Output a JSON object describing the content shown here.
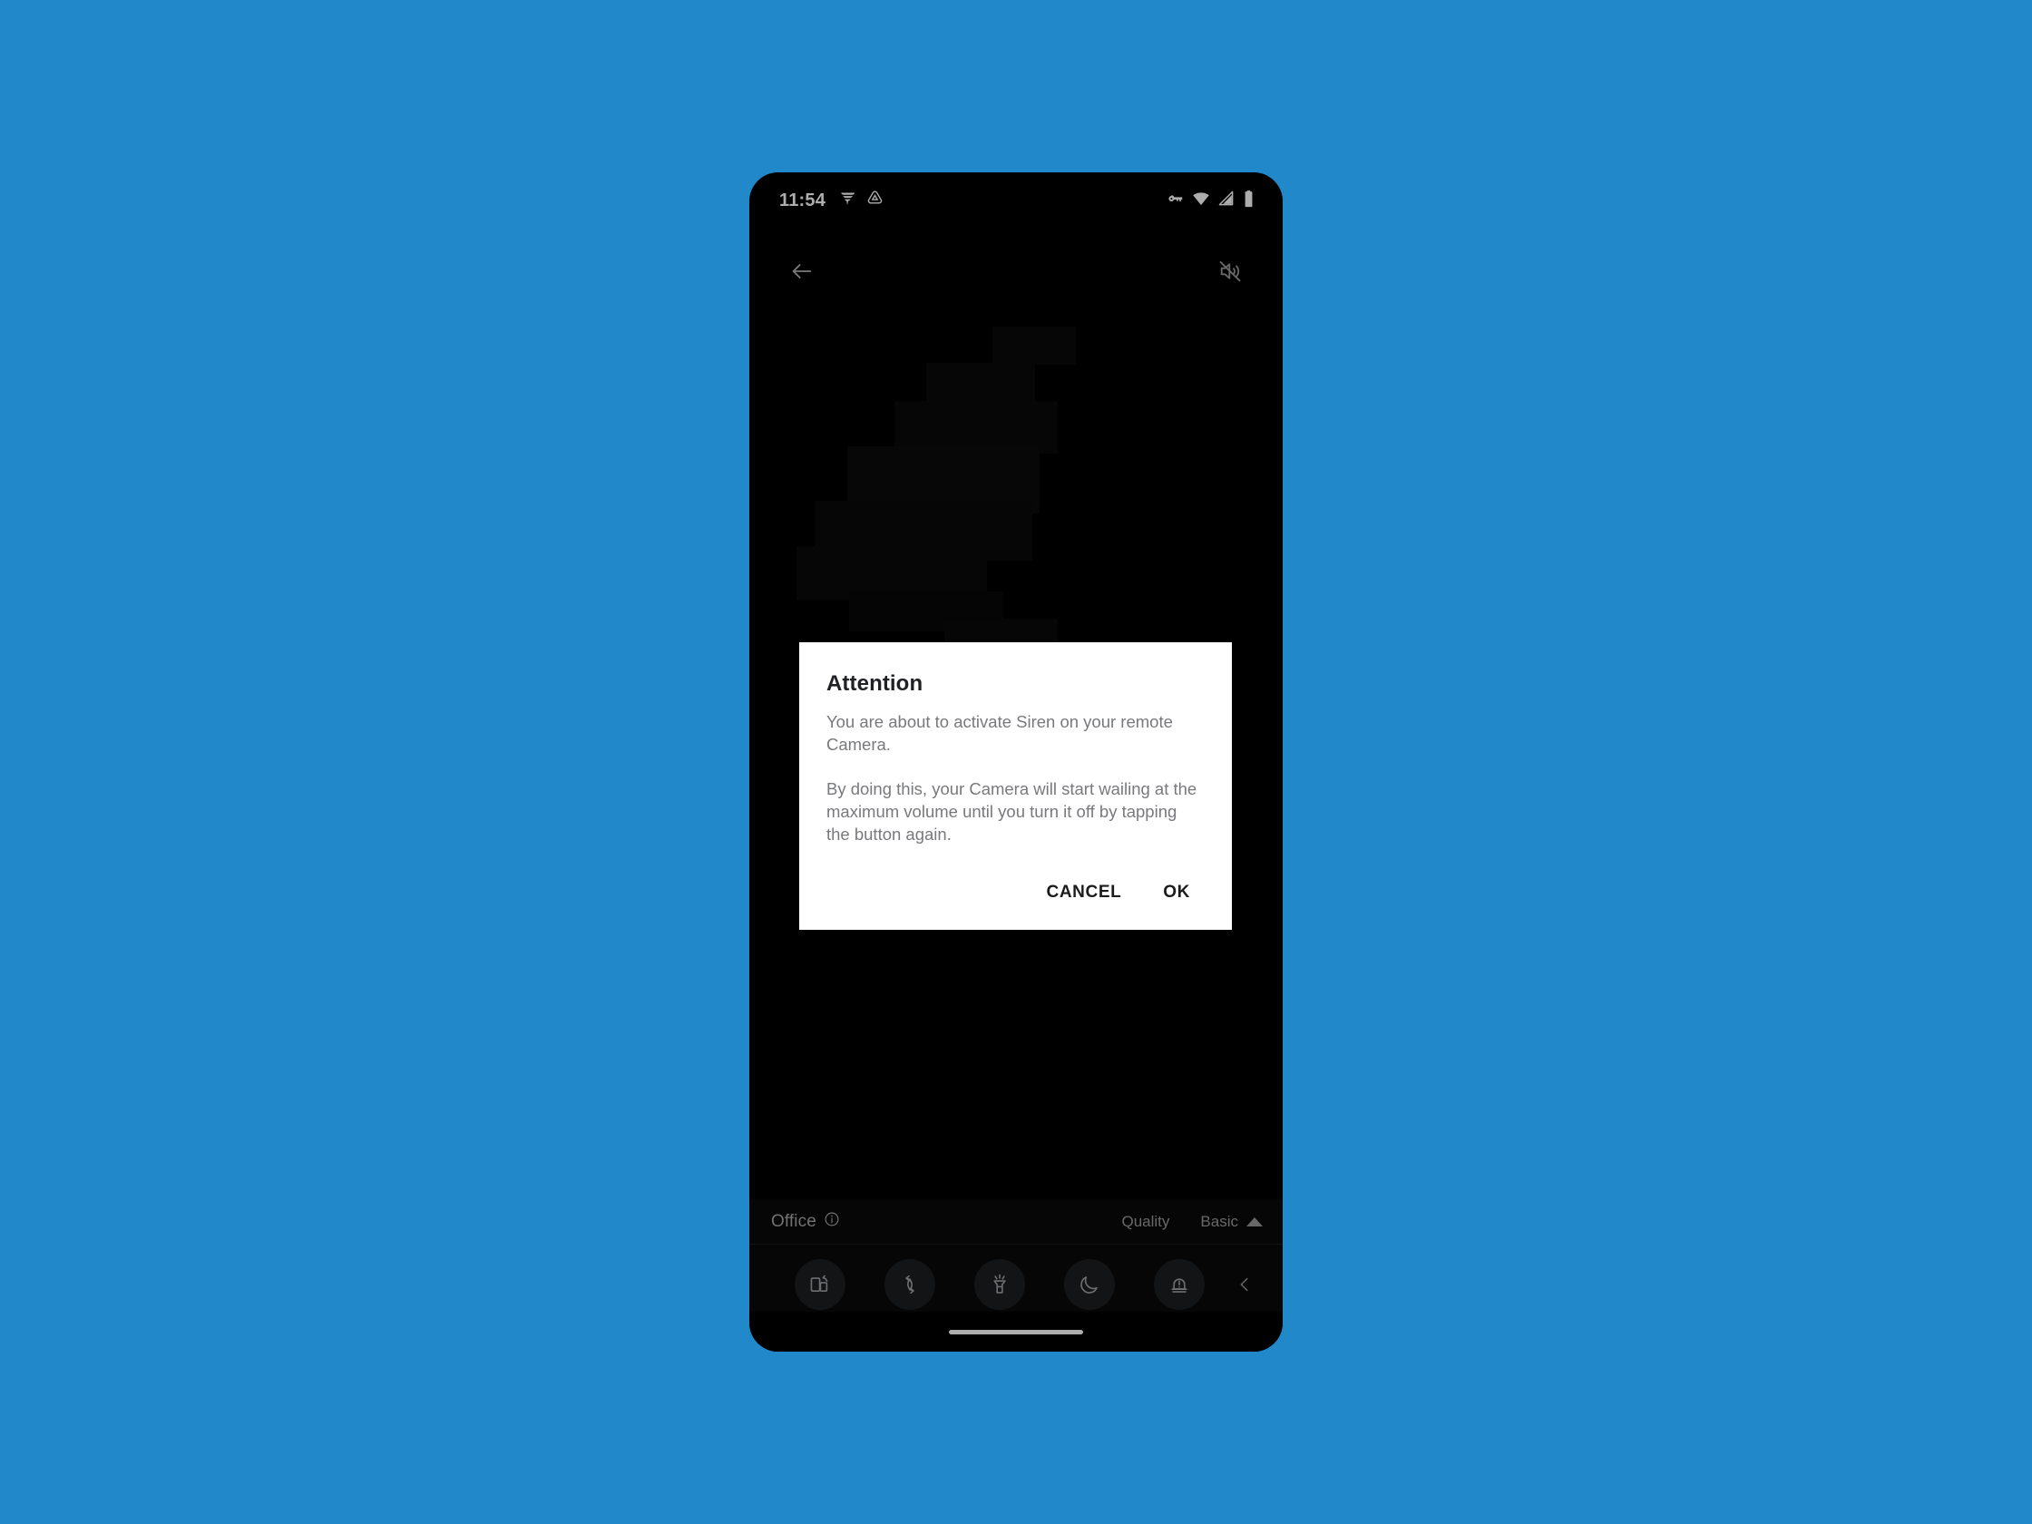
{
  "background": {
    "color": "#2189c9"
  },
  "phone": {
    "status_bar": {
      "clock": "11:54",
      "left_icons": [
        {
          "name": "tornado-notification-icon",
          "glyph": "tornado"
        },
        {
          "name": "triangle-app-notification-icon",
          "glyph": "triangle-badge"
        }
      ],
      "right_icons": [
        {
          "name": "vpn-key-icon",
          "glyph": "key"
        },
        {
          "name": "wifi-icon",
          "glyph": "wifi-full"
        },
        {
          "name": "cellular-signal-icon",
          "glyph": "signal-partial"
        },
        {
          "name": "battery-icon",
          "glyph": "battery-full"
        }
      ]
    },
    "stream": {
      "back_button_label": "Back",
      "mute_button_label": "Volume off"
    },
    "bottom_panel": {
      "device_name": "Office",
      "info_icon": "info-outline-icon",
      "quality_label": "Quality",
      "quality_value": "Basic",
      "quality_chevron": "triangle-up-icon",
      "collapse_icon": "chevron-left-icon",
      "actions": [
        {
          "label": "Rotate",
          "icon": "rotate-phone-icon"
        },
        {
          "label": "Switch",
          "icon": "switch-camera-icon"
        },
        {
          "label": "Flashlight",
          "icon": "flashlight-icon"
        },
        {
          "label": "Low-Light",
          "icon": "moon-icon"
        },
        {
          "label": "Siren",
          "icon": "siren-beacon-icon"
        }
      ]
    },
    "home_indicator": "home-gesture-bar"
  },
  "dialog": {
    "title": "Attention",
    "paragraph_1": "You are about to activate Siren on your remote Camera.",
    "paragraph_2": "By doing this, your Camera will start wailing at the maximum volume until you turn it off by tapping the button again.",
    "cancel_label": "CANCEL",
    "ok_label": "OK"
  }
}
